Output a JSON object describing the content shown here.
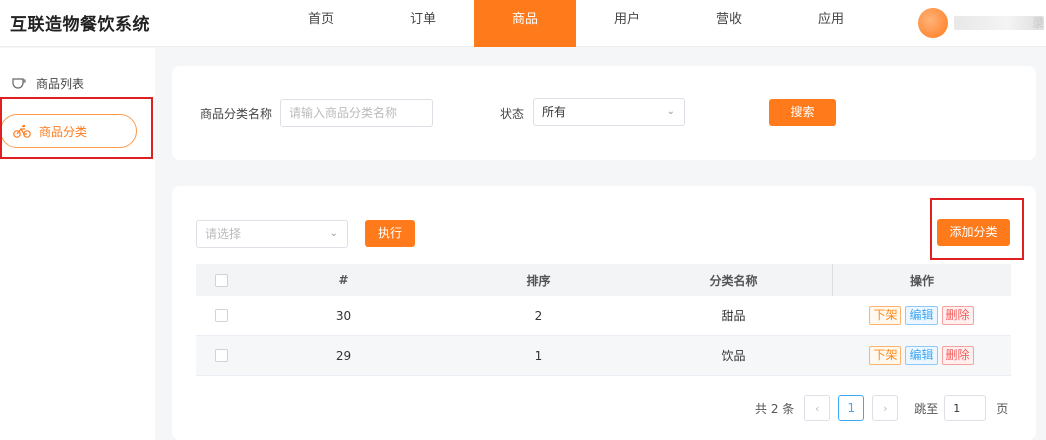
{
  "app": {
    "title": "互联造物餐饮系统"
  },
  "nav": {
    "items": [
      "首页",
      "订单",
      "商品",
      "用户",
      "营收",
      "应用"
    ],
    "active": "商品"
  },
  "user": {
    "name_fragment": "录"
  },
  "sidebar": {
    "items": [
      {
        "label": "商品列表",
        "icon": "cup-icon"
      },
      {
        "label": "商品分类",
        "icon": "bicycle-icon",
        "active": true
      }
    ]
  },
  "search": {
    "name_label": "商品分类名称",
    "name_placeholder": "请输入商品分类名称",
    "status_label": "状态",
    "status_value": "所有",
    "search_button": "搜索"
  },
  "bulk": {
    "select_placeholder": "请选择",
    "execute_button": "执行",
    "add_button": "添加分类"
  },
  "table": {
    "headers": {
      "id": "#",
      "sort": "排序",
      "name": "分类名称",
      "ops": "操作"
    },
    "rows": [
      {
        "id": "30",
        "sort": "2",
        "name": "甜品"
      },
      {
        "id": "29",
        "sort": "1",
        "name": "饮品"
      }
    ],
    "actions": {
      "off": "下架",
      "edit": "编辑",
      "delete": "删除"
    }
  },
  "pagination": {
    "total": "共 2 条",
    "current": "1",
    "prev": "‹",
    "next": "›",
    "goto_label": "跳至",
    "goto_value": "1",
    "page_suffix": "页"
  },
  "colors": {
    "accent": "#ff7a1a",
    "highlight_box": "#e02020"
  }
}
